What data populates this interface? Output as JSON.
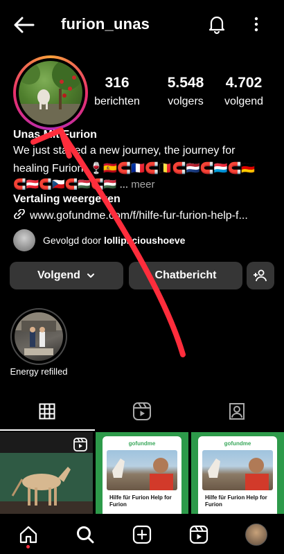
{
  "header": {
    "username": "furion_unas"
  },
  "stats": [
    {
      "value": "316",
      "label": "berichten"
    },
    {
      "value": "5.548",
      "label": "volgers"
    },
    {
      "value": "4.702",
      "label": "volgend"
    }
  ],
  "profile": {
    "name": "Unas Mit Furion",
    "bio_line1": "We just started a new journey, the journey for",
    "bio_line2": "healing Furion. 🍷🇪🇸🧲🇫🇷🧲🇧🇪🧲🇳🇱🧲🇱🇺🧲🇩🇪",
    "bio_line3": "🧲🇦🇹🧲🇨🇿🧲🇭🇺🧲🇭🇺 ...",
    "more": "meer",
    "translate": "Vertaling weergeven",
    "link": "www.gofundme.com/f/hilfe-fur-furion-help-f..."
  },
  "followed_by": {
    "prefix": "Gevolgd door",
    "user": "lolliplicioushoeve"
  },
  "buttons": {
    "following": "Volgend",
    "message": "Chatbericht"
  },
  "highlight": {
    "label": "Energy refilled"
  },
  "posts": {
    "card_brand": "gofundme",
    "card_title": "Hilfe für Furion Help for Furion"
  },
  "colors": {
    "accent_arrow": "#ff2d3c",
    "ring_start": "#f9a13a",
    "ring_end": "#b52cb4"
  }
}
